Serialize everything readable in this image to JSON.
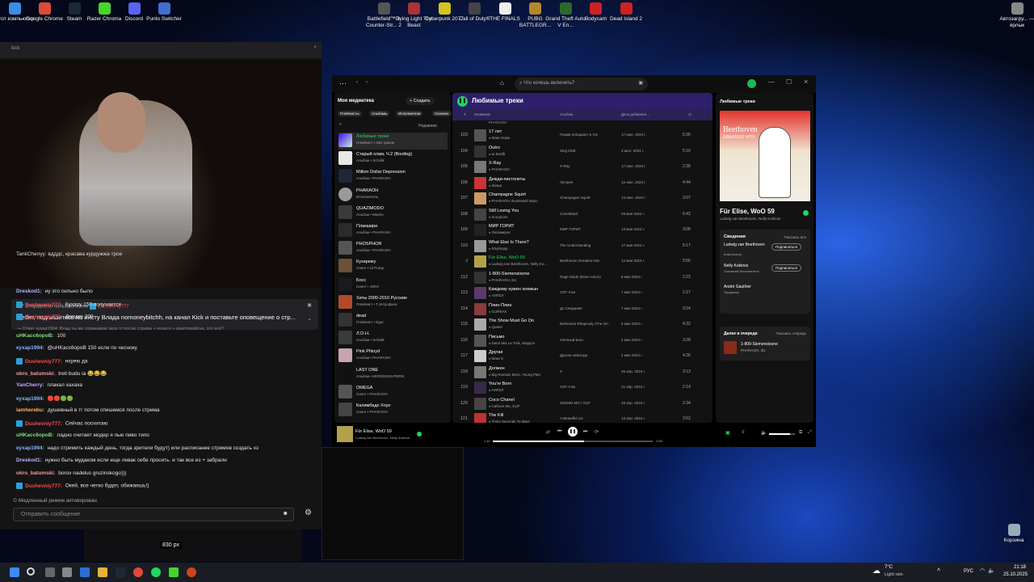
{
  "desktop": {
    "icons_left": [
      "Этот компьютер",
      "Google Chrome",
      "Steam",
      "Razer Chroma",
      "Discord",
      "Punto Switcher"
    ],
    "icons_top": [
      "Battlefield™ 6 Counter-Str... 2",
      "Dying Light The Beast",
      "Cyberpunk 2077",
      "Call of Duty®",
      "THE FINALS",
      "PUBG BATTLEGR...",
      "Grand Theft Auto V En...",
      "Bodycam",
      "Dead Island 2"
    ],
    "icon_right": "Автозагру... — ярлык",
    "recycle_bin": "Корзина"
  },
  "stream": {
    "tab": "kick",
    "pinned_by": "Отправлено пользователем",
    "pinned_user": "Dushevniy777",
    "pinned_text": "Ребят, подпишитесь на инсту Влада nomoneybitchh, на канал Kick и поставьте оповещение о стр...",
    "top_cut": "TankChenyy: вдддс, красава курдужжа трое",
    "messages": [
      {
        "user": "Dreskod1:",
        "text": " ну это сильно было",
        "color": "#b8b8ff",
        "badge": false
      },
      {
        "user": "Dushevniy777:",
        "text": " Кухару 150 получается",
        "color": "#ff4a4a",
        "badge": true
      },
      {
        "user": "Dushevniy777:",
        "text": " Дождку 200",
        "color": "#ff4a4a",
        "badge": true
      },
      {
        "user": "",
        "text": "⮡ Ответ кухар1994: Влад ты же спрашивал мою тг после стрима + колесо + криптовойска, это всё?",
        "color": "#888",
        "badge": false
      },
      {
        "user": "uHKacc6opoB:",
        "text": " 100",
        "color": "#7ee07e",
        "badge": false
      },
      {
        "user": "кухар1994:",
        "text": " @uHKacc6opoB 150 если по чесноку",
        "color": "#8ab4ff",
        "badge": false
      },
      {
        "user": "Dushevniy777:",
        "text": " нхуею да",
        "color": "#ff4a4a",
        "badge": true
      },
      {
        "user": "okro_batumski:",
        "text": " treti budu ia 😂😂😂",
        "color": "#ff9a9a",
        "badge": false
      },
      {
        "user": "YanCherry:",
        "text": " плакал хахаха",
        "color": "#c5a7ff",
        "badge": false
      },
      {
        "user": "кухар1994:",
        "text": " 🔴🔴🟢🟢",
        "color": "#8ab4ff",
        "badge": false
      },
      {
        "user": "iamherebu:",
        "text": " душевный в тг потом спишемся после стрима",
        "color": "#ffb45a",
        "badge": false
      },
      {
        "user": "Dushevniy777:",
        "text": " Сейчас посчитаю",
        "color": "#ff4a4a",
        "badge": true
      },
      {
        "user": "uHKacc6opoB:",
        "text": " ладно считает модер я пью пиво типо",
        "color": "#7ee07e",
        "badge": false
      },
      {
        "user": "кухар1994:",
        "text": " надо стримить каждый день, тогда зрители будут) или расписание стримов создать хз",
        "color": "#8ab4ff",
        "badge": false
      },
      {
        "user": "Dreskod1:",
        "text": " нужно быть мудаком если еще левак себе просить. и так все из + забрали",
        "color": "#b8b8ff",
        "badge": false
      },
      {
        "user": "okro_batumski:",
        "text": " borov nadelus gruzinskogo)))",
        "color": "#ff9a9a",
        "badge": false
      },
      {
        "user": "Dushevniy777:",
        "text": " Окей, все четко будет, обижаешь!)",
        "color": "#ff4a4a",
        "badge": true
      }
    ],
    "slow_mode": "Медленный режим активирован",
    "send_placeholder": "Отправить сообщение",
    "px_label": "830 px"
  },
  "spotify": {
    "search_placeholder": "Что хочешь включить?",
    "library": {
      "title": "Моя медиатека",
      "create": "+ Создать",
      "chips": [
        "Плейлисты",
        "Альбомы",
        "Исполнители",
        "Скачано"
      ],
      "sort": "Недавние",
      "items": [
        {
          "t1": "Любимые треки",
          "t2": "Плейлист • 436 треков",
          "c": "linear-gradient(135deg,#450af5,#c4efd9)"
        },
        {
          "t1": "Старый хлам, Ч.2 (Bootleg)",
          "t2": "Альбом • Scholik",
          "c": "#e8e8e8"
        },
        {
          "t1": "Million Dollar Depression",
          "t2": "Альбом • PHARAOH",
          "c": "#1c2838"
        },
        {
          "t1": "PHARAOH",
          "t2": "Исполнитель",
          "c": "#9a9a9a"
        },
        {
          "t1": "QUAZIMODO",
          "t2": "Альбом • Masiro",
          "c": "#3a3a3a"
        },
        {
          "t1": "Плакшири",
          "t2": "Альбом • PHARAOH",
          "c": "#2b2b2b"
        },
        {
          "t1": "PHOSPHOR",
          "t2": "Альбом • PHARAOH",
          "c": "#555"
        },
        {
          "t1": "Кухарежу",
          "t2": "Сингл • Lil Pump",
          "c": "#6a5138"
        },
        {
          "t1": "Босс",
          "t2": "Сингл • JONY",
          "c": "#1a1a1a"
        },
        {
          "t1": "Хиты 2000-2010 Русские",
          "t2": "Плейлист • Т.Jeтрофиоv",
          "c": "#b24a2a"
        },
        {
          "t1": "dead",
          "t2": "Плейлист • Egor",
          "c": "#333"
        },
        {
          "t1": "Л.О.Н.",
          "t2": "Альбом • Scholik",
          "c": "#3a3a3a"
        },
        {
          "t1": "Pink Phloyd",
          "t2": "Альбом • PHARAOH",
          "c": "#c8a4b0"
        },
        {
          "t1": "LAST ONE",
          "t2": "Альбом • MORGENSHTERN",
          "c": "#111"
        },
        {
          "t1": "OMEGA",
          "t2": "Сингл • PHARAOH",
          "c": "#555"
        },
        {
          "t1": "Калимбадо Хоуо",
          "t2": "Сингл • PHARAOH",
          "c": "#444"
        }
      ]
    },
    "main": {
      "title": "Любимые треки",
      "cols": [
        "#",
        "Название",
        "Альбом",
        "Дата добавлен...",
        "◷"
      ],
      "first_row_cut": "PHARAOH",
      "tracks": [
        {
          "n": "103",
          "t": "17 лет",
          "a": "Макс Корж",
          "al": "Пожив попадают в топ",
          "d": "17 июн. 2024 г.",
          "du": "5:36",
          "c": "#555"
        },
        {
          "n": "104",
          "t": "Outro",
          "a": "Ы Килl$",
          "al": "Sing Kla$",
          "d": "3 июл. 2024 г.",
          "du": "5:16",
          "c": "#333"
        },
        {
          "n": "105",
          "t": "X-Ray",
          "a": "PHARAOH",
          "al": "X-Ray",
          "d": "17 июл. 2024 г.",
          "du": "2:38",
          "c": "#777"
        },
        {
          "n": "106",
          "t": "Дежди-пистолеты",
          "a": "Звери",
          "al": "Лучшее",
          "d": "12 июн. 2024 г.",
          "du": "4:44",
          "c": "#c33"
        },
        {
          "n": "107",
          "t": "Champagne Squirt",
          "a": "PHARAOH, Boulevard Depo",
          "al": "Champagne Squirt",
          "d": "12 июн. 2024 г.",
          "du": "3:07",
          "c": "#c96"
        },
        {
          "n": "108",
          "t": "Still Loving You",
          "a": "Scorpions",
          "al": "Comeblack",
          "d": "29 мая 2024 г.",
          "du": "6:43",
          "c": "#444"
        },
        {
          "n": "109",
          "t": "МИР ГОРИТ",
          "a": "Окcимирон",
          "al": "МИР ГОРИТ",
          "d": "13 мая 2024 г.",
          "du": "3:08",
          "c": "#222"
        },
        {
          "n": "110",
          "t": "What Else Is There?",
          "a": "Röyksopp",
          "al": "The Understanding",
          "d": "17 мая 2024 г.",
          "du": "5:17",
          "c": "#999"
        },
        {
          "n": "ıl",
          "t": "Für Elise, WoO 59",
          "a": "Ludwig van Beethoven, Nelly Ko...",
          "al": "Beethoven Greatest Hits",
          "d": "12 мая 2024 г.",
          "du": "2:56",
          "c": "#b5a04a"
        },
        {
          "n": "112",
          "t": "1-800-Siemensixone",
          "a": "PHARAOH, i61",
          "al": "Rage Mode (Rare Action)",
          "d": "8 мая 2024 г.",
          "du": "2:23",
          "c": "#333"
        },
        {
          "n": "113",
          "t": "Каждому нужен хоемын",
          "a": "АИГЕЛ",
          "al": "OST Ітом",
          "d": "7 мая 2024 г.",
          "du": "2:27",
          "c": "#5a3a6a"
        },
        {
          "n": "114",
          "t": "Плин-Плин",
          "a": "IC3PEAK",
          "al": "До Свидания",
          "d": "7 мая 2024 г.",
          "du": "3:24",
          "c": "#8a3a3a"
        },
        {
          "n": "115",
          "t": "The Show Must Go On",
          "a": "Queen",
          "al": "Bohemian Rhapsody (The Ori...",
          "d": "5 мая 2024 г.",
          "du": "4:32",
          "c": "#aaa"
        },
        {
          "n": "116",
          "t": "Письмо",
          "a": "Detol aka Le Truk, Маруся",
          "al": "Уличный Босс",
          "d": "2 мая 2024 г.",
          "du": "3:28",
          "c": "#555"
        },
        {
          "n": "117",
          "t": "Другая",
          "a": "Макс К",
          "al": "Другая навсегда",
          "d": "2 мая 2024 г.",
          "du": "4:26",
          "c": "#ccc"
        },
        {
          "n": "118",
          "t": "Должен",
          "a": "Big Russian Boss, Young P&H",
          "al": "X",
          "d": "26 апр. 2024 г.",
          "du": "3:13",
          "c": "#777"
        },
        {
          "n": "119",
          "t": "You're Born",
          "a": "АИГЕЛ",
          "al": "OST Ітом",
          "d": "21 апр. 2024 г.",
          "du": "2:14",
          "c": "#3a2a4a"
        },
        {
          "n": "120",
          "t": "Coco Chanel",
          "a": "Сибсон Мо, GUF",
          "al": "СМОКИ МО / GUF",
          "d": "19 апр. 2024 г.",
          "du": "2:34",
          "c": "#444"
        },
        {
          "n": "121",
          "t": "The Kill",
          "a": "Thirty Seconds To Mars",
          "al": "A Beautiful Lie",
          "d": "13 апр. 2024 г.",
          "du": "3:52",
          "c": "#b33"
        }
      ]
    },
    "now_playing": {
      "header": "Любимые треки",
      "title": "Für Elise, WoO 59",
      "artist": "Ludwig van Beethoven, Nelly Kokinos",
      "cover_top": "Beethoven",
      "cover_sub": "GREATEST HITS",
      "credits_title": "Сведения",
      "show_all": "Показать все",
      "credits": [
        {
          "name": "Ludwig van Beethoven",
          "role": "Композитор",
          "btn": "Подписаться"
        },
        {
          "name": "Nelly Kokinos",
          "role": "Основной Исполнитель",
          "btn": "Подписаться"
        },
        {
          "name": "André Gauthier",
          "role": "Продюсер",
          "btn": ""
        }
      ],
      "queue_title": "Далее в очереди",
      "queue_open": "Показать очередь",
      "queue_track": "1-800-Siemensixone",
      "queue_artist": "PHARAOH, i61"
    },
    "player": {
      "title": "Für Elise, WoO 59",
      "artist": "Ludwig van Beethoven, Nelly Kokinos",
      "elapsed": "1:40",
      "total": "2:56",
      "progress": 0.57,
      "volume": 0.8
    }
  },
  "taskbar": {
    "weather_temp": "7°C",
    "weather_text": "Light rain",
    "lang": "РУС",
    "time": "21:18",
    "date": "25.10.2025"
  }
}
